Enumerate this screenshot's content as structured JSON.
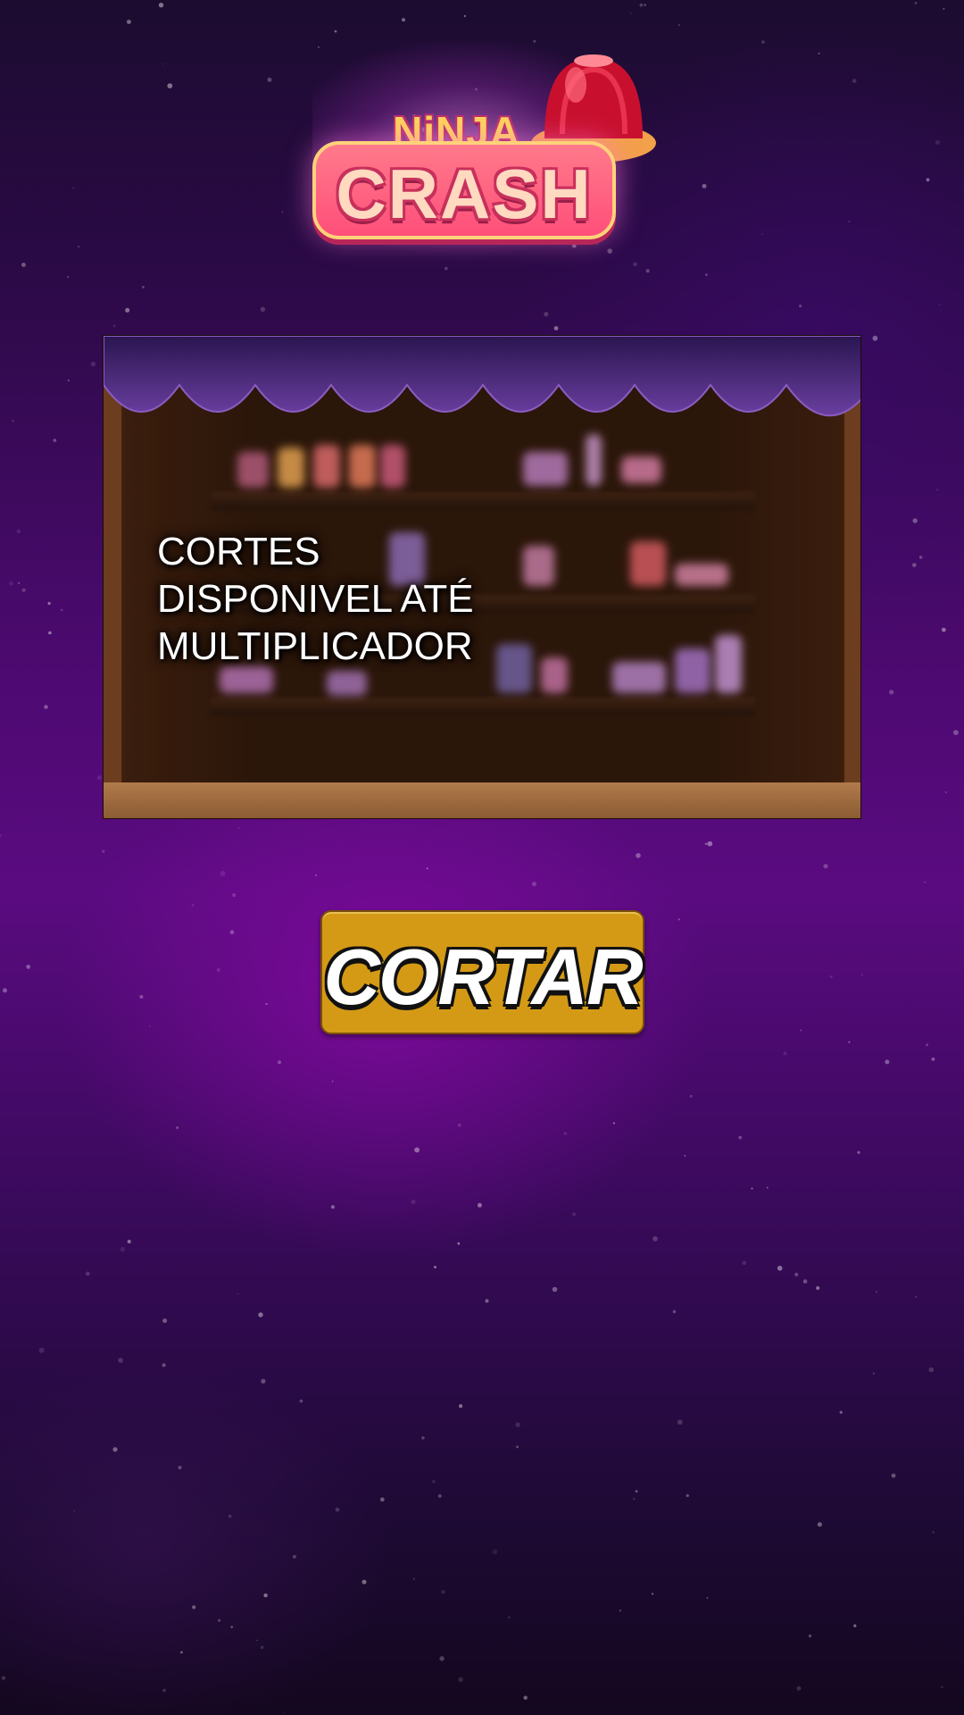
{
  "logo": {
    "line1": "NiNJA",
    "line2": "CRASH"
  },
  "panel": {
    "line1": "CORTES",
    "line2": "DISPONIVEL ATÉ",
    "line3": "MULTIPLICADOR"
  },
  "actions": {
    "cut_label": "CORTAR"
  },
  "colors": {
    "button": "#d49a16",
    "background": "#5a0b80",
    "logo_red": "#ff4f7a"
  },
  "icons": [
    "jelly-icon",
    "star-particles"
  ]
}
